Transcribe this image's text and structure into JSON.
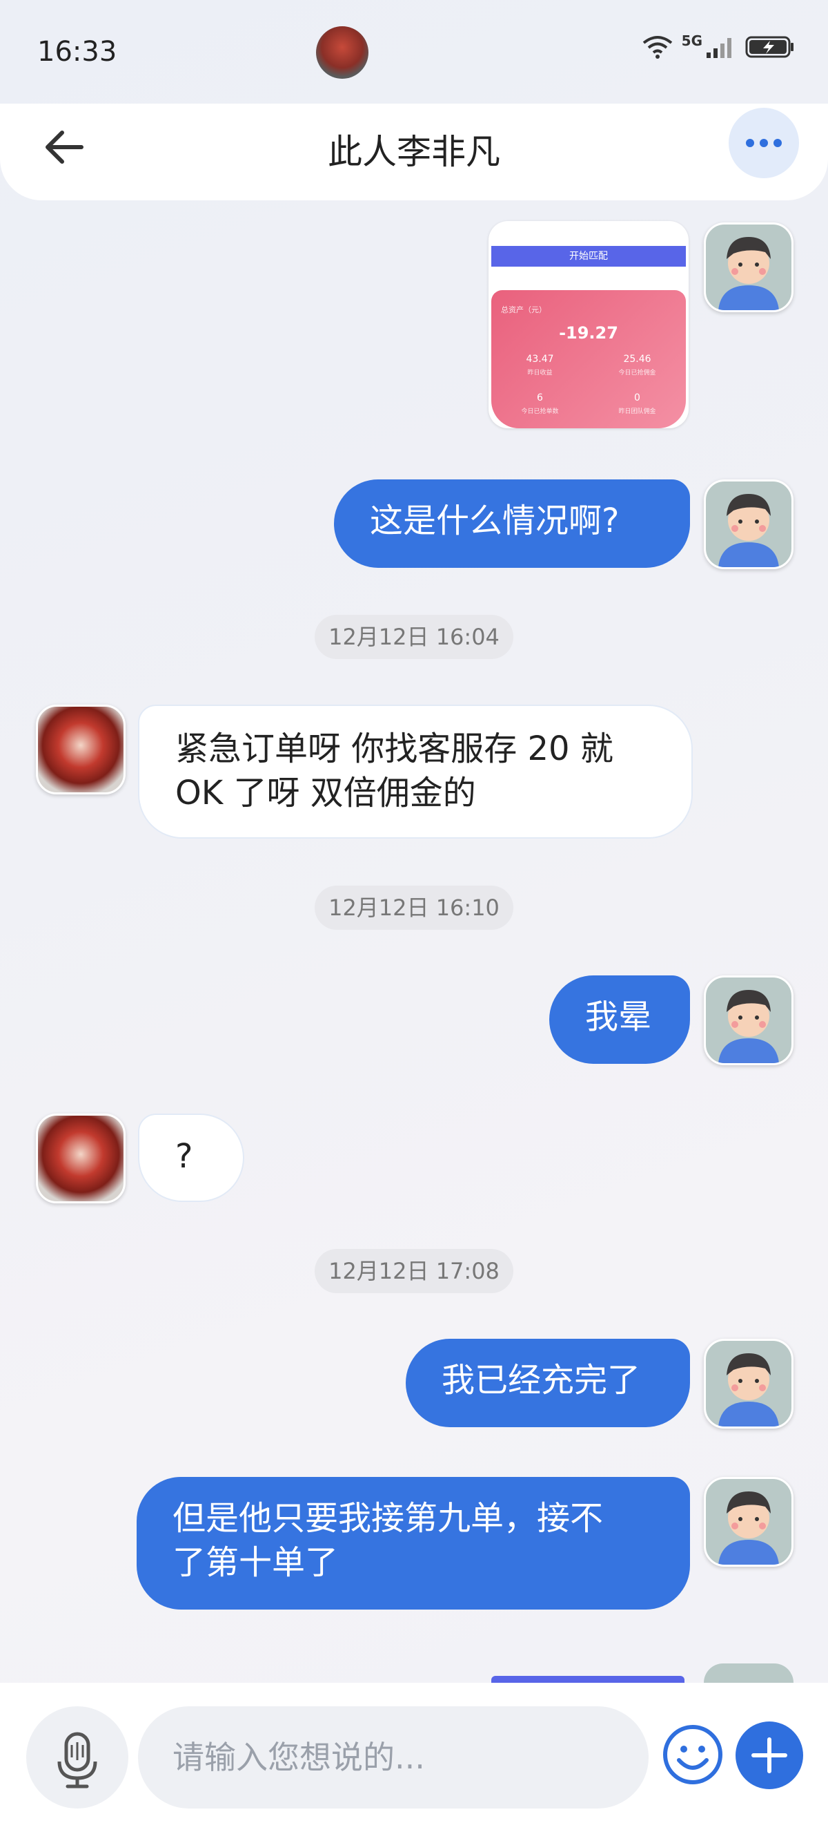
{
  "status_bar": {
    "time": "16:33",
    "network": "5G"
  },
  "header": {
    "title": "此人李非凡"
  },
  "screenshot_card": {
    "button_label": "开始匹配",
    "total_label": "总资产（元）",
    "total_value": "-19.27",
    "stats": [
      {
        "value": "43.47",
        "label": "昨日收益"
      },
      {
        "value": "25.46",
        "label": "今日已抢佣金"
      },
      {
        "value": "6",
        "label": "今日已抢单数"
      },
      {
        "value": "0",
        "label": "昨日团队佣金"
      }
    ]
  },
  "messages": [
    {
      "from": "me",
      "text": "这是什么情况啊?"
    },
    {
      "from": "timestamp",
      "text": "12月12日 16:04"
    },
    {
      "from": "other",
      "lines": [
        "紧急订单呀  你找客服存 20 就",
        "OK 了呀  双倍佣金的"
      ]
    },
    {
      "from": "timestamp",
      "text": "12月12日 16:10"
    },
    {
      "from": "me",
      "text": "我晕"
    },
    {
      "from": "other",
      "text": "?"
    },
    {
      "from": "timestamp",
      "text": "12月12日 17:08"
    },
    {
      "from": "me",
      "text": "我已经充完了"
    },
    {
      "from": "me",
      "lines": [
        "但是他只要我接第九单，接不",
        "了第十单了"
      ]
    }
  ],
  "composer": {
    "placeholder": "请输入您想说的..."
  },
  "icons": [
    "back-arrow-icon",
    "more-dots-icon",
    "microphone-icon",
    "emoji-icon",
    "plus-icon",
    "wifi-icon",
    "signal-icon",
    "battery-charging-icon"
  ]
}
